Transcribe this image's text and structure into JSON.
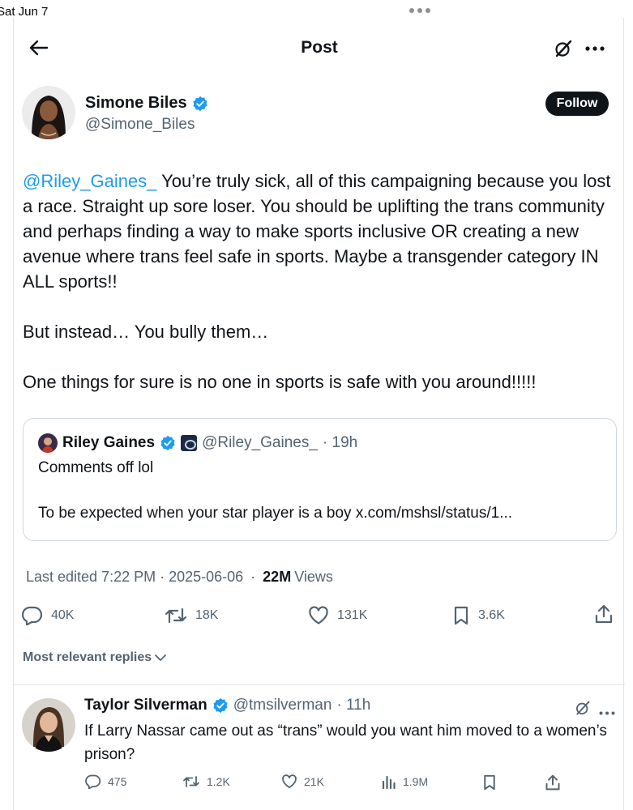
{
  "status_bar": {
    "date": "Sat Jun 7"
  },
  "header": {
    "title": "Post"
  },
  "author": {
    "name": "Simone Biles",
    "handle": "@Simone_Biles",
    "follow_label": "Follow"
  },
  "tweet": {
    "mention": "@Riley_Gaines_",
    "para1_rest": " You’re truly sick, all of this campaigning because you lost a race. Straight up sore loser. You should be uplifting the trans community and perhaps finding a way to make sports inclusive OR creating a new avenue where trans feel safe in sports. Maybe a transgender category IN ALL sports!!",
    "para2": "But instead… You bully them…",
    "para3": "One things for sure is no one in sports is safe with you around!!!!!"
  },
  "quote": {
    "name": "Riley Gaines",
    "handle": "@Riley_Gaines_",
    "time": "· 19h",
    "line1": "Comments off lol",
    "line2": "To be expected when your star player is a boy x.com/mshsl/status/1..."
  },
  "meta": {
    "edited": "Last edited 7:22 PM · 2025-06-06",
    "sep": " · ",
    "views_count": "22M",
    "views_label": "Views"
  },
  "actions": {
    "replies": "40K",
    "reposts": "18K",
    "likes": "131K",
    "bookmarks": "3.6K"
  },
  "replies_filter": {
    "label": "Most relevant replies"
  },
  "reply": {
    "name": "Taylor Silverman",
    "handle": "@tmsilverman",
    "time": "· 11h",
    "text": "If Larry Nassar came out as “trans” would you want him moved to a women’s prison?",
    "replies": "475",
    "reposts": "1.2K",
    "likes": "21K",
    "views": "1.9M"
  },
  "colors": {
    "accent": "#1d9bf0",
    "text": "#0f1419",
    "muted": "#536471",
    "border": "#cfd9de"
  },
  "icons": [
    "back-arrow-icon",
    "grok-icon",
    "more-icon",
    "verified-badge-icon",
    "affiliate-badge-icon",
    "reply-icon",
    "repost-icon",
    "like-icon",
    "bookmark-icon",
    "share-icon",
    "views-icon",
    "chevron-down-icon"
  ]
}
